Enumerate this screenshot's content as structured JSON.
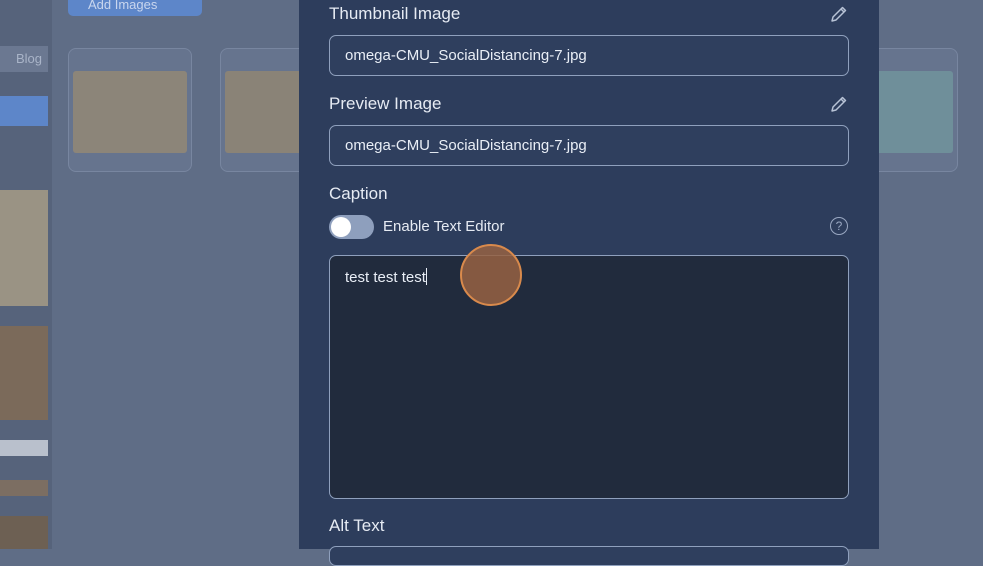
{
  "background": {
    "add_images_label": "Add Images",
    "sidebar_text": "Blog"
  },
  "modal": {
    "thumbnail": {
      "label": "Thumbnail Image",
      "value": "omega-CMU_SocialDistancing-7.jpg"
    },
    "preview": {
      "label": "Preview Image",
      "value": "omega-CMU_SocialDistancing-7.jpg"
    },
    "caption": {
      "label": "Caption",
      "toggle_label": "Enable Text Editor",
      "toggle_on": false,
      "help_glyph": "?",
      "text": "test test test"
    },
    "alt_text": {
      "label": "Alt Text",
      "value": ""
    }
  },
  "colors": {
    "modal_bg": "#2d3d5c",
    "input_border": "#8fa0bd",
    "textarea_bg": "#212b3d",
    "cursor_highlight": "#d98a4c"
  }
}
